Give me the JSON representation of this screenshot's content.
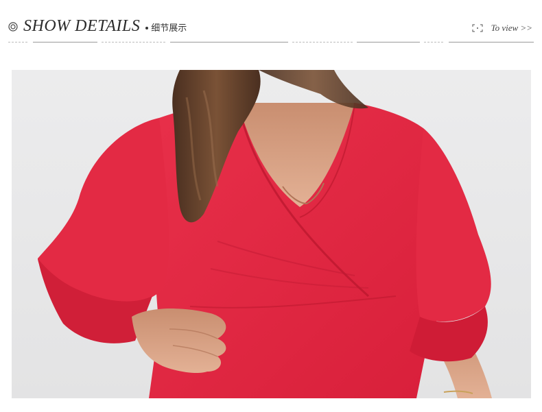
{
  "header": {
    "title": "SHOW DETAILS",
    "subtitle": "细节展示",
    "view_link": "To view >>"
  },
  "icons": {
    "title_icon": "target-icon",
    "view_icon": "fullscreen-icon"
  },
  "photo": {
    "alt": "model wearing red wrap dress with flared sleeves",
    "colors": {
      "background": "#e9e9ea",
      "dress": "#e0243d",
      "dress_shadow": "#b8162c",
      "skin": "#dca688",
      "hair": "#5a3a27"
    }
  }
}
